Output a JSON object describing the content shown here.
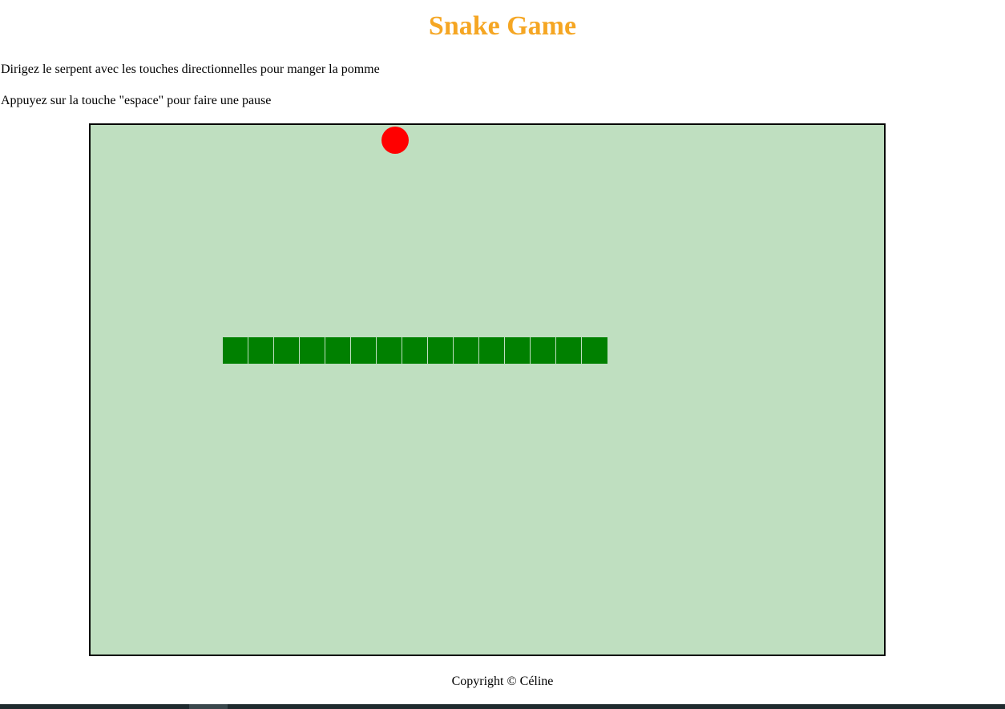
{
  "header": {
    "title": "Snake Game",
    "title_color": "#f5a623"
  },
  "instructions": [
    "Dirigez le serpent avec les touches directionnelles pour manger la pomme",
    "Appuyez sur la touche \"espace\" pour faire une pause"
  ],
  "game": {
    "board_color": "#bfdfc0",
    "snake_color": "#008000",
    "apple_color": "#ff0000",
    "snake_length": 15
  },
  "footer": {
    "copyright": "Copyright © Céline"
  }
}
